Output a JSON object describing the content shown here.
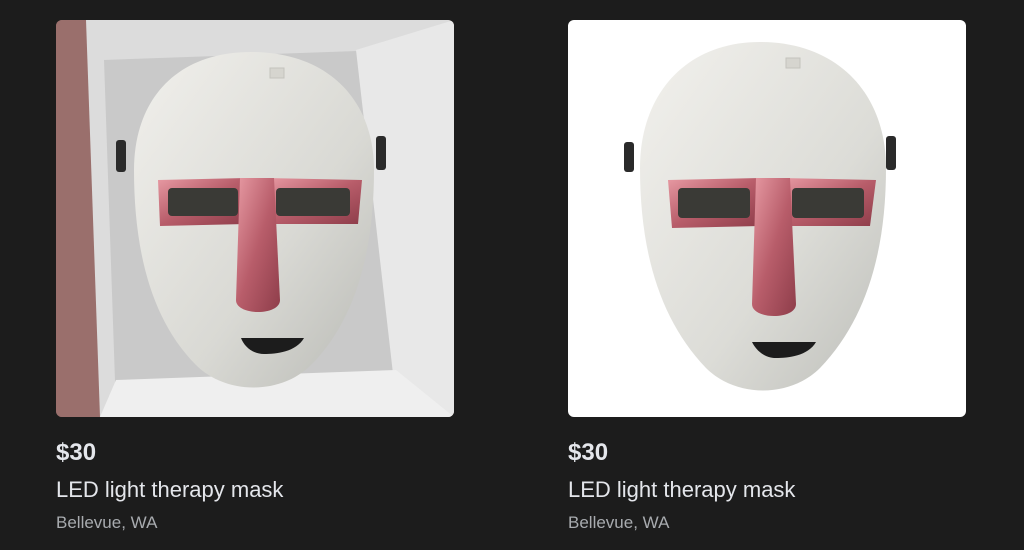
{
  "listings": [
    {
      "price": "$30",
      "title": "LED light therapy mask",
      "location": "Bellevue, WA",
      "image_icon": "led-mask-photo-in-box"
    },
    {
      "price": "$30",
      "title": "LED light therapy mask",
      "location": "Bellevue, WA",
      "image_icon": "led-mask-photo-white-background"
    }
  ],
  "colors": {
    "page_background": "#1c1c1c",
    "text_primary": "#e4e6eb",
    "text_secondary": "#a8abaf",
    "mask_accent": "#c9727e"
  }
}
